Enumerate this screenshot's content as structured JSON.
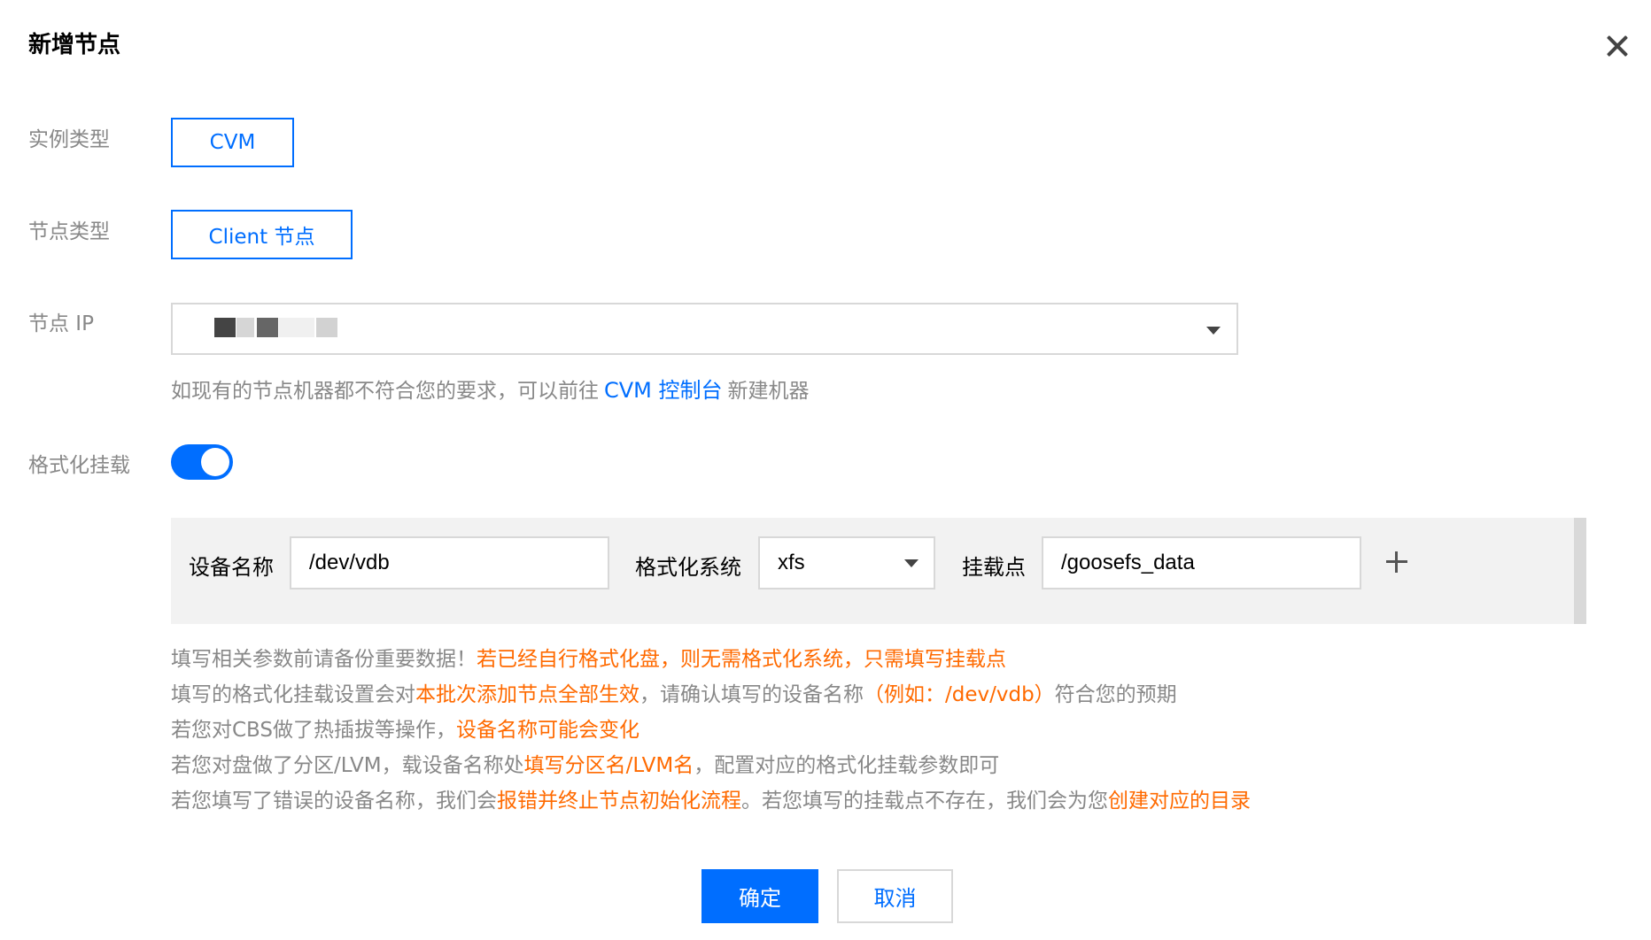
{
  "dialog": {
    "title": "新增节点"
  },
  "form": {
    "instance_type": {
      "label": "实例类型",
      "value": "CVM"
    },
    "node_type": {
      "label": "节点类型",
      "value": "Client 节点"
    },
    "node_ip": {
      "label": "节点 IP",
      "value": ""
    },
    "hint": {
      "prefix": "如现有的节点机器都不符合您的要求，可以前往",
      "link": "CVM 控制台",
      "suffix": "新建机器"
    },
    "format_mount": {
      "label": "格式化挂载",
      "enabled": true
    }
  },
  "mount_row": {
    "device_label": "设备名称",
    "device_value": "/dev/vdb",
    "fs_label": "格式化系统",
    "fs_value": "xfs",
    "mount_label": "挂载点",
    "mount_value": "/goosefs_data"
  },
  "notes": {
    "line1": {
      "a": "填写相关参数前请备份重要数据！",
      "b": "若已经自行格式化盘，则无需格式化系统，只需填写挂载点"
    },
    "line2": {
      "a": "填写的格式化挂载设置会对",
      "b": "本批次添加节点全部生效",
      "c": "，请确认填写的设备名称",
      "d": "（例如：/dev/vdb）",
      "e": "符合您的预期"
    },
    "line3": {
      "a": "若您对CBS做了热插拔等操作，",
      "b": "设备名称可能会变化"
    },
    "line4": {
      "a": "若您对盘做了分区/LVM，载设备名称处",
      "b": "填写分区名/LVM名",
      "c": "，配置对应的格式化挂载参数即可"
    },
    "line5": {
      "a": "若您填写了错误的设备名称，我们会",
      "b": "报错并终止节点初始化流程",
      "c": "。若您填写的挂载点不存在，我们会为您",
      "d": "创建对应的目录"
    }
  },
  "footer": {
    "confirm": "确定",
    "cancel": "取消"
  },
  "colors": {
    "primary": "#006eff",
    "warning": "#ff6a00",
    "muted": "#888888"
  }
}
